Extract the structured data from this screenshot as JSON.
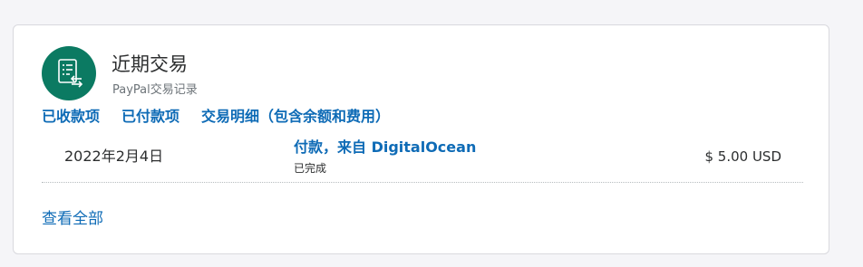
{
  "card": {
    "title": "近期交易",
    "subtitle": "PayPal交易记录",
    "icon": "transaction-list-icon",
    "accent_color": "#0b7a62",
    "link_color": "#0e6bb6"
  },
  "tabs": [
    {
      "label": "已收款项"
    },
    {
      "label": "已付款项"
    },
    {
      "label": "交易明细（包含余额和费用）"
    }
  ],
  "transactions": [
    {
      "date": "2022年2月4日",
      "description": "付款，来自 DigitalOcean",
      "status": "已完成",
      "amount": "$ 5.00 USD"
    }
  ],
  "view_all_label": "查看全部"
}
